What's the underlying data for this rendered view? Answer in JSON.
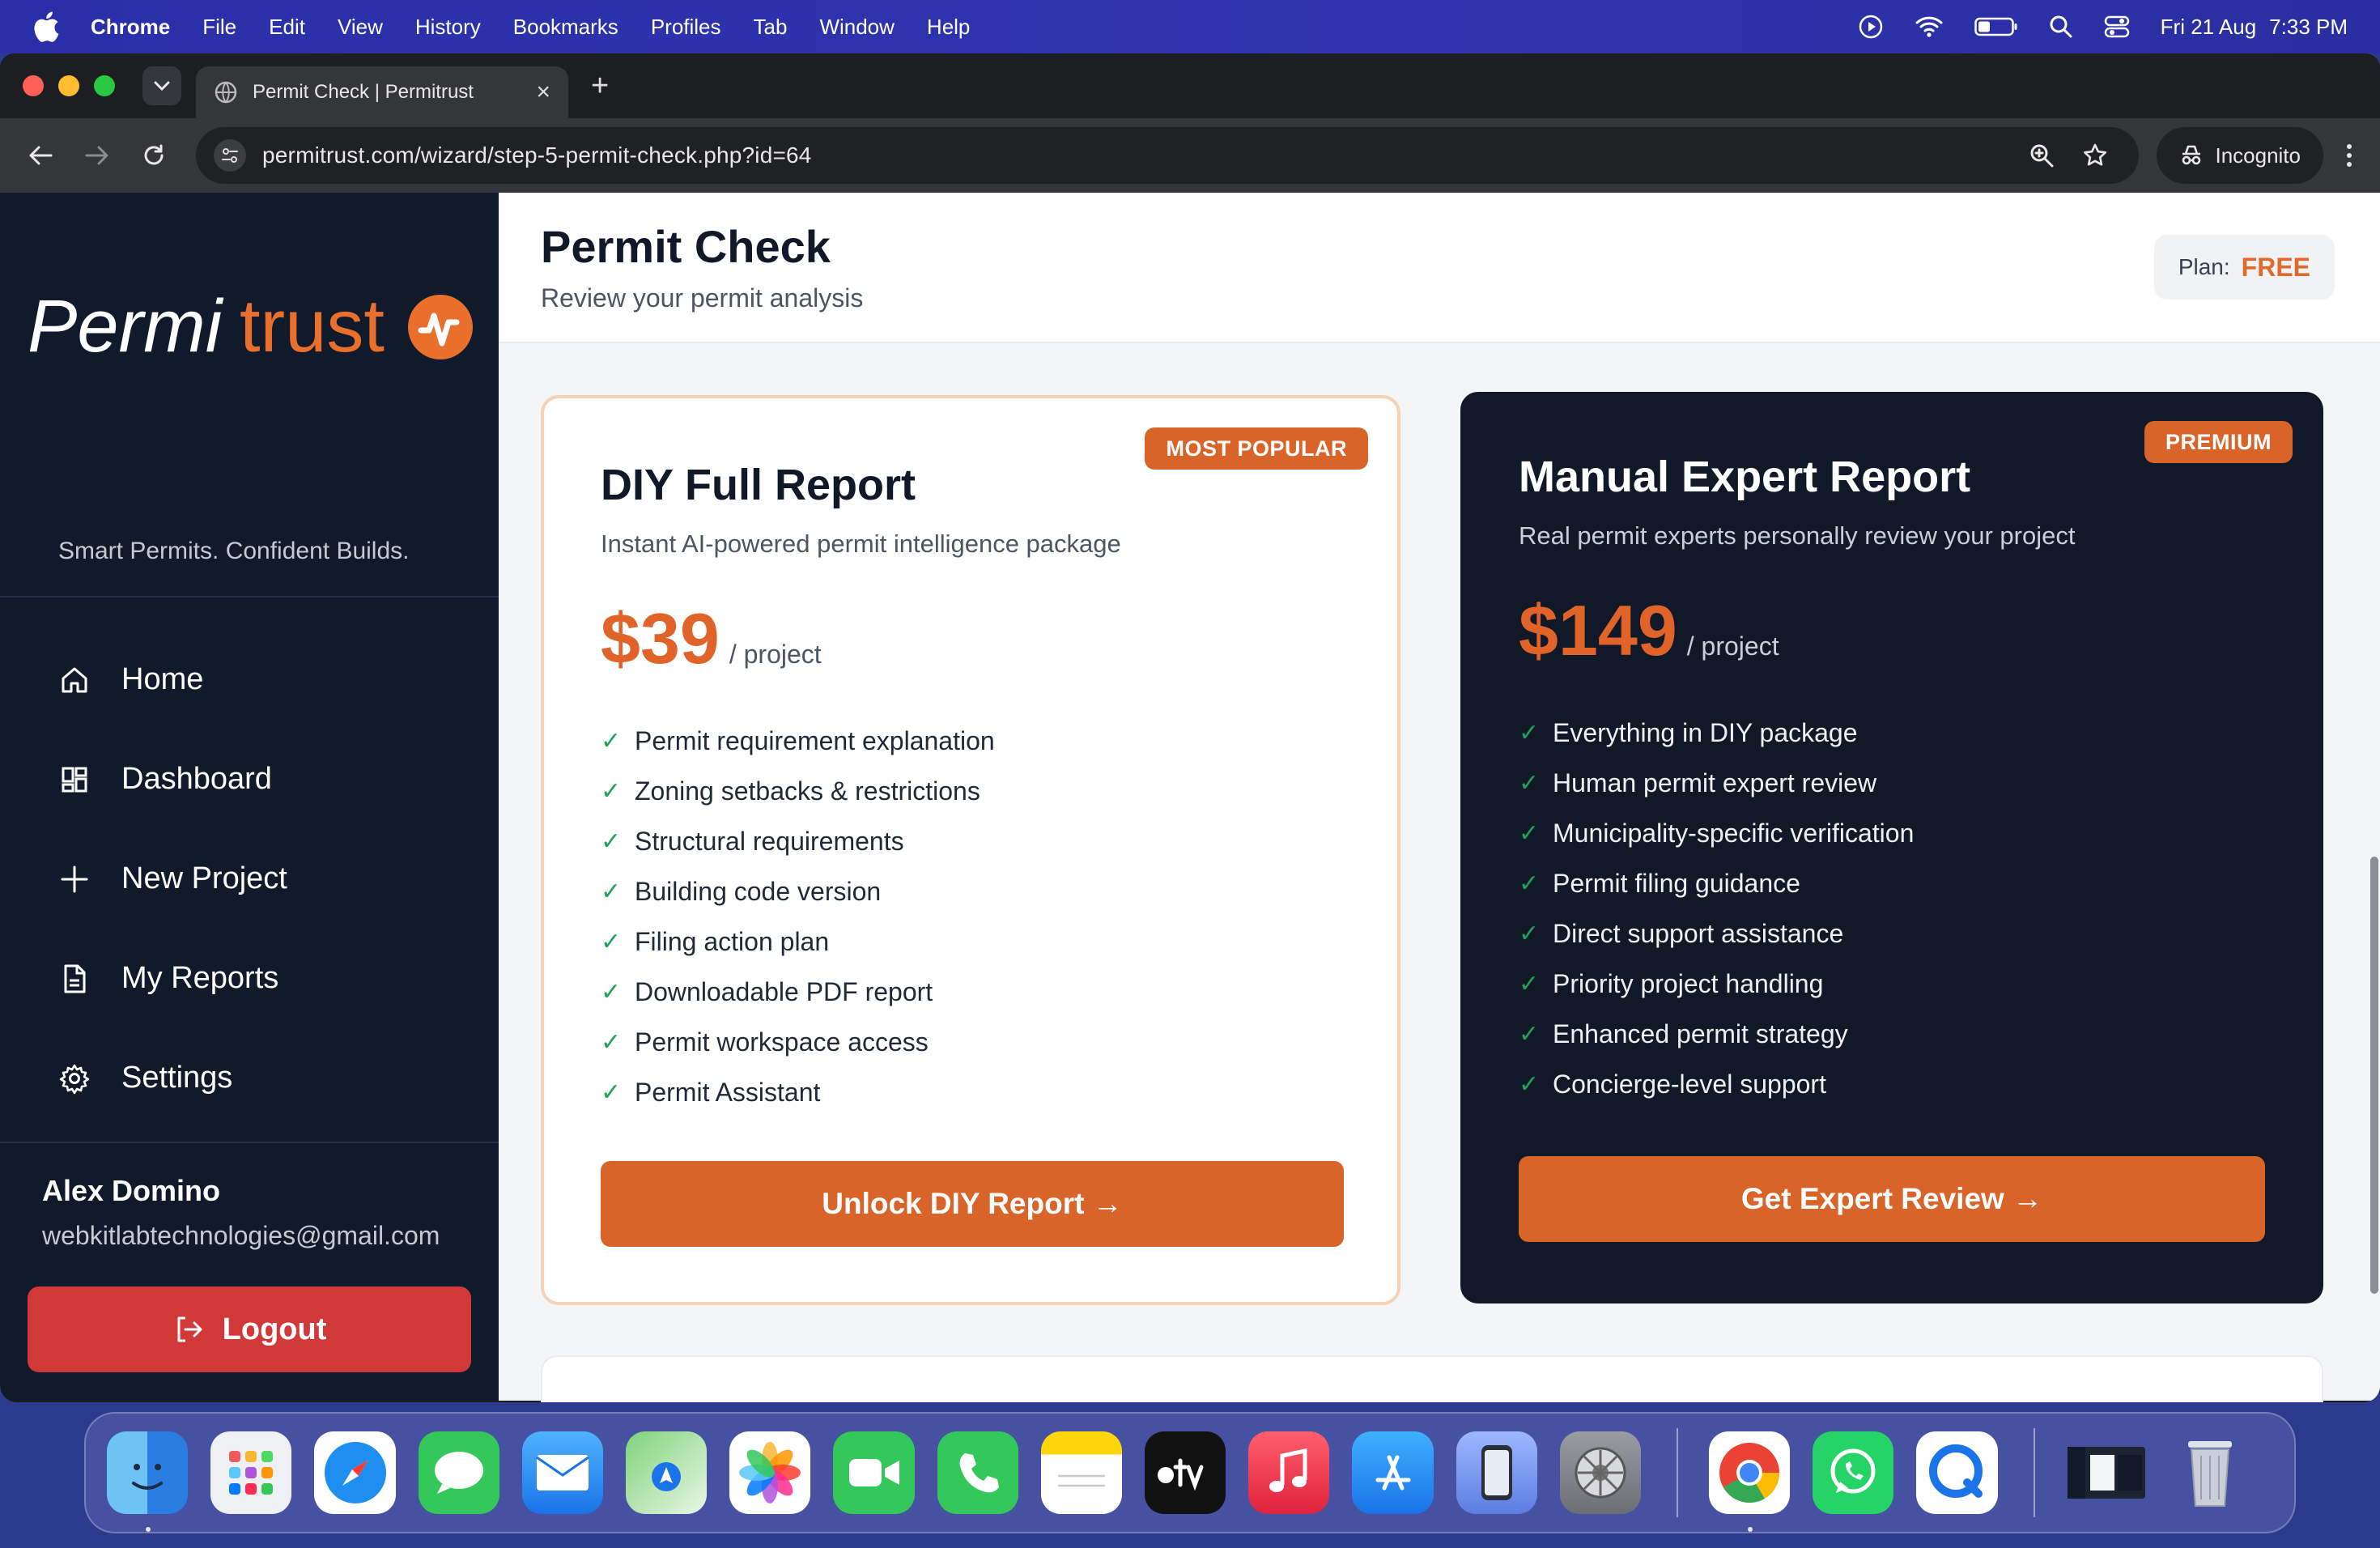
{
  "menubar": {
    "app": "Chrome",
    "items": [
      "File",
      "Edit",
      "View",
      "History",
      "Bookmarks",
      "Profiles",
      "Tab",
      "Window",
      "Help"
    ],
    "date": "Fri 21 Aug",
    "time": "7:33 PM"
  },
  "browser": {
    "tab_title": "Permit Check | Permitrust",
    "url": "permitrust.com/wizard/step-5-permit-check.php?id=64",
    "incognito_label": "Incognito"
  },
  "sidebar": {
    "logo_text_a": "Permi",
    "logo_text_b": "trust",
    "tagline": "Smart Permits. Confident Builds.",
    "nav": [
      {
        "label": "Home",
        "icon": "home-icon"
      },
      {
        "label": "Dashboard",
        "icon": "dashboard-icon"
      },
      {
        "label": "New Project",
        "icon": "plus-icon"
      },
      {
        "label": "My Reports",
        "icon": "document-icon"
      },
      {
        "label": "Settings",
        "icon": "gear-icon"
      }
    ],
    "user_name": "Alex Domino",
    "user_email": "webkitlabtechnologies@gmail.com",
    "logout_label": "Logout"
  },
  "header": {
    "title": "Permit Check",
    "subtitle": "Review your permit analysis",
    "plan_label": "Plan:",
    "plan_value": "FREE"
  },
  "cards": {
    "diy": {
      "badge": "MOST POPULAR",
      "title": "DIY Full Report",
      "description": "Instant AI-powered permit intelligence package",
      "price": "$39",
      "per": "/ project",
      "features": [
        "Permit requirement explanation",
        "Zoning setbacks & restrictions",
        "Structural requirements",
        "Building code version",
        "Filing action plan",
        "Downloadable PDF report",
        "Permit workspace access",
        "Permit Assistant"
      ],
      "cta": "Unlock DIY Report →"
    },
    "expert": {
      "badge": "PREMIUM",
      "title": "Manual Expert Report",
      "description": "Real permit experts personally review your project",
      "price": "$149",
      "per": "/ project",
      "features": [
        "Everything in DIY package",
        "Human permit expert review",
        "Municipality-specific verification",
        "Permit filing guidance",
        "Direct support assistance",
        "Priority project handling",
        "Enhanced permit strategy",
        "Concierge-level support"
      ],
      "cta": "Get Expert Review →"
    }
  },
  "colors": {
    "accent": "#d9642a",
    "sidebar_bg": "#101a2b",
    "logout": "#d13838",
    "check": "#22a15a"
  },
  "dock": {
    "apps": [
      "finder",
      "launchpad",
      "safari",
      "messages",
      "mail",
      "maps",
      "photos",
      "facetime",
      "phone",
      "notes",
      "tv",
      "music",
      "app-store",
      "iphone-mirroring",
      "system-settings",
      "chrome",
      "whatsapp",
      "quicktime",
      "screenshot",
      "trash"
    ]
  }
}
